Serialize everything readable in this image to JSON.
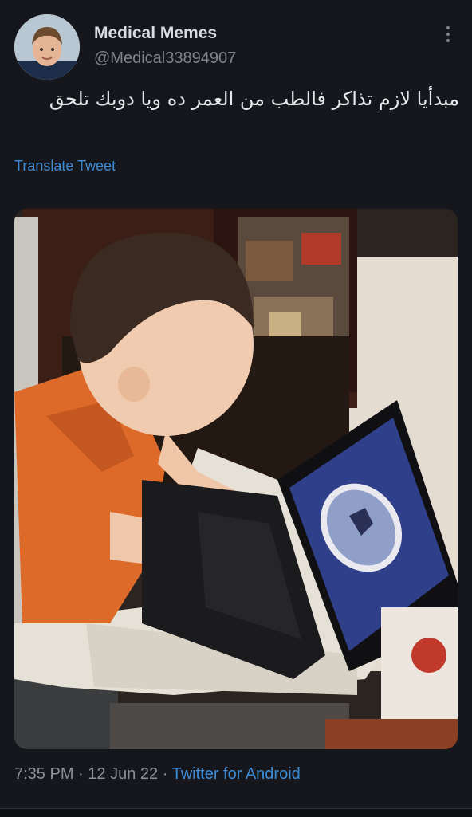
{
  "tweet": {
    "display_name": "Medical Memes",
    "handle": "@Medical33894907",
    "text": "مبدأيا لازم تذاكر فالطب من العمر ده ويا دوبك تلحق",
    "translate_label": "Translate Tweet",
    "time": "7:35 PM",
    "date": "12 Jun 22",
    "separator": "·",
    "source": "Twitter for Android"
  },
  "icons": {
    "more": "more-vertical-icon",
    "avatar": "avatar-photo-child",
    "media": "photo-toddler-using-laptop-brain-ct"
  },
  "colors": {
    "background": "#15171c",
    "link": "#3e8bd6",
    "primary_text": "#e6e8eb",
    "secondary_text": "#7f858c"
  }
}
